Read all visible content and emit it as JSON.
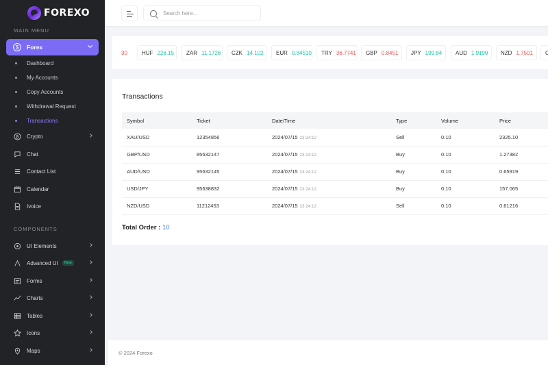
{
  "brand": {
    "name": "FOREXO"
  },
  "sidebar": {
    "main_menu_title": "MAIN MENU",
    "forex_label": "Forex",
    "sub_items": [
      {
        "label": "Dashboard"
      },
      {
        "label": "My Accounts"
      },
      {
        "label": "Copy Accounts"
      },
      {
        "label": "Withdrawal Request"
      },
      {
        "label": "Transactions",
        "active": true
      }
    ],
    "items": [
      {
        "label": "Crypto",
        "icon": "bitcoin-icon",
        "has_submenu": true
      },
      {
        "label": "Chat",
        "icon": "chat-icon",
        "has_submenu": false
      },
      {
        "label": "Contact List",
        "icon": "contact-list-icon",
        "has_submenu": false
      },
      {
        "label": "Calendar",
        "icon": "calendar-icon",
        "has_submenu": false
      },
      {
        "label": "Ivoice",
        "icon": "invoice-icon",
        "has_submenu": false
      }
    ],
    "components_title": "COMPONENTS",
    "components": [
      {
        "label": "UI Elements",
        "icon": "ui-elements-icon",
        "has_submenu": true
      },
      {
        "label": "Advanced UI",
        "icon": "advanced-ui-icon",
        "has_submenu": true,
        "badge": "New"
      },
      {
        "label": "Forms",
        "icon": "forms-icon",
        "has_submenu": true
      },
      {
        "label": "Charts",
        "icon": "charts-icon",
        "has_submenu": true
      },
      {
        "label": "Tables",
        "icon": "tables-icon",
        "has_submenu": true
      },
      {
        "label": "Icons",
        "icon": "icons-icon",
        "has_submenu": true
      },
      {
        "label": "Maps",
        "icon": "maps-icon",
        "has_submenu": true
      }
    ]
  },
  "topbar": {
    "search_placeholder": "Search here..."
  },
  "ticker": {
    "partial_left": "30",
    "items": [
      {
        "currency": "HUF",
        "value": "226.15",
        "trend": "up"
      },
      {
        "currency": "ZAR",
        "value": "11.1726",
        "trend": "up"
      },
      {
        "currency": "CZK",
        "value": "14.102",
        "trend": "up"
      },
      {
        "currency": "EUR",
        "value": "0.84510",
        "trend": "up"
      },
      {
        "currency": "TRY",
        "value": "36.7741",
        "trend": "down"
      },
      {
        "currency": "GBP",
        "value": "0.8451",
        "trend": "down"
      },
      {
        "currency": "JPY",
        "value": "199.84",
        "trend": "up"
      },
      {
        "currency": "AUD",
        "value": "1.9190",
        "trend": "up"
      },
      {
        "currency": "NZD",
        "value": "1.7501",
        "trend": "down"
      }
    ],
    "partial_right": "C"
  },
  "transactions": {
    "title": "Transactions",
    "columns": [
      "Symbol",
      "Ticket",
      "Date/Time",
      "Type",
      "Volume",
      "Price"
    ],
    "rows": [
      {
        "symbol": "XAU/USD",
        "ticket": "12354856",
        "date": "2024/07/15",
        "time": "23:24:12",
        "type": "Sell",
        "volume": "0.10",
        "price": "2325.10"
      },
      {
        "symbol": "GBP/USD",
        "ticket": "85632147",
        "date": "2024/07/15",
        "time": "23:24:12",
        "type": "Buy",
        "volume": "0.10",
        "price": "1.27382"
      },
      {
        "symbol": "AUD/USD",
        "ticket": "95632145",
        "date": "2024/07/15",
        "time": "23:24:12",
        "type": "Buy",
        "volume": "0.10",
        "price": "0.65919"
      },
      {
        "symbol": "USD/JPY",
        "ticket": "95638832",
        "date": "2024/07/15",
        "time": "23:24:12",
        "type": "Buy",
        "volume": "0.10",
        "price": "157.065"
      },
      {
        "symbol": "NZD/USD",
        "ticket": "11212453",
        "date": "2024/07/15",
        "time": "23:24:12",
        "type": "Sell",
        "volume": "0.10",
        "price": "0.61216"
      }
    ],
    "total_label": "Total Order :",
    "total_value": "10"
  },
  "footer": {
    "copyright": "© 2024 Forexo"
  },
  "colors": {
    "accent": "#7b6cf6",
    "up": "#1ec5a6",
    "down": "#f05454",
    "sidebar_bg": "#222327"
  }
}
